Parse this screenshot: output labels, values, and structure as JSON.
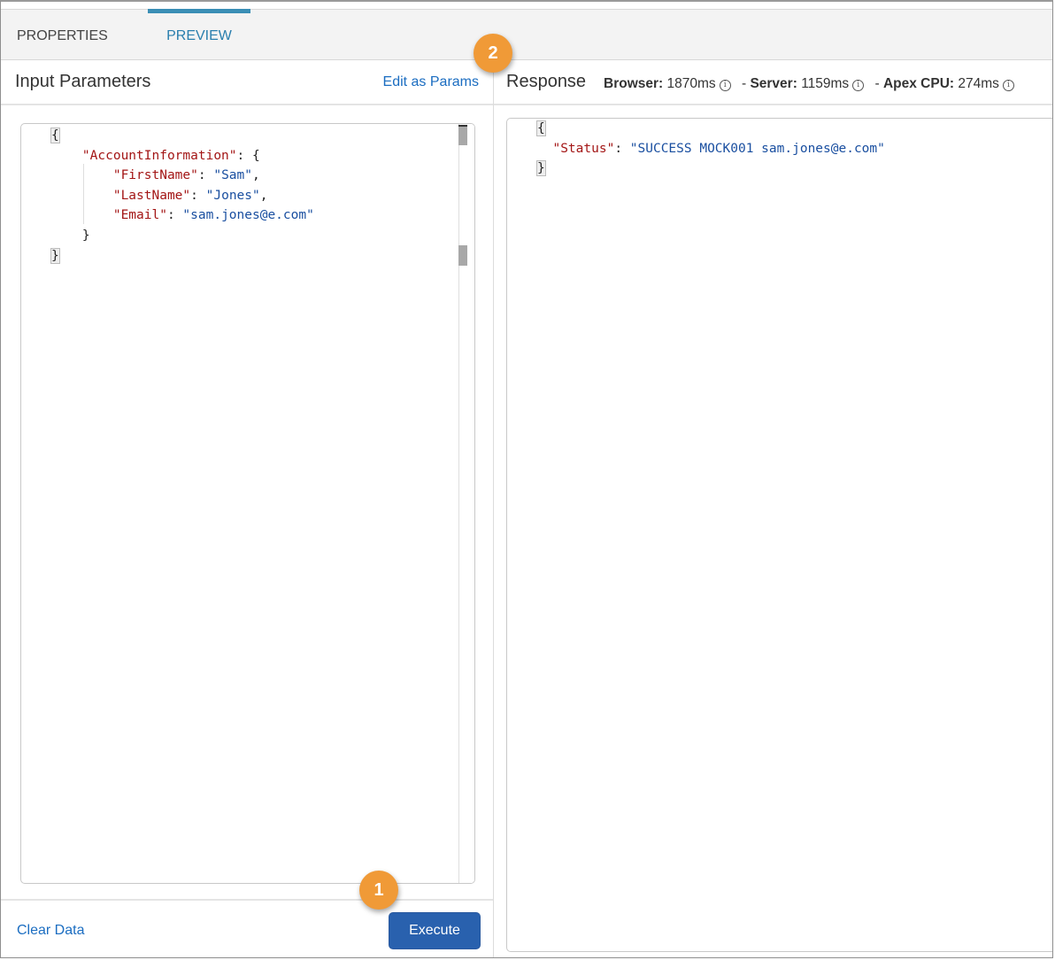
{
  "tabs": [
    {
      "label": "PROPERTIES",
      "active": false
    },
    {
      "label": "PREVIEW",
      "active": true
    }
  ],
  "input_panel": {
    "title": "Input Parameters",
    "edit_link": "Edit as Params",
    "code_lines": [
      [
        {
          "t": "{",
          "c": "brace-hl"
        }
      ],
      [
        {
          "t": "    "
        },
        {
          "t": "\"AccountInformation\"",
          "c": "key"
        },
        {
          "t": ": {"
        }
      ],
      [
        {
          "t": "        "
        },
        {
          "t": "\"FirstName\"",
          "c": "key"
        },
        {
          "t": ": "
        },
        {
          "t": "\"Sam\"",
          "c": "str"
        },
        {
          "t": ","
        }
      ],
      [
        {
          "t": "        "
        },
        {
          "t": "\"LastName\"",
          "c": "key"
        },
        {
          "t": ": "
        },
        {
          "t": "\"Jones\"",
          "c": "str"
        },
        {
          "t": ","
        }
      ],
      [
        {
          "t": "        "
        },
        {
          "t": "\"Email\"",
          "c": "key"
        },
        {
          "t": ": "
        },
        {
          "t": "\"sam.jones@e.com\"",
          "c": "str"
        }
      ],
      [
        {
          "t": "    }"
        }
      ],
      [
        {
          "t": "}",
          "c": "brace-hl"
        }
      ]
    ]
  },
  "response_panel": {
    "title": "Response",
    "metrics": [
      {
        "label": "Browser:",
        "value": "1870ms",
        "prefix": ""
      },
      {
        "label": "Server:",
        "value": "1159ms",
        "prefix": "- "
      },
      {
        "label": "Apex CPU:",
        "value": "274ms",
        "prefix": "- "
      }
    ],
    "info_icon": "ⓘ",
    "code_lines": [
      [
        {
          "t": "{",
          "c": "brace-hl"
        }
      ],
      [
        {
          "t": "  "
        },
        {
          "t": "\"Status\"",
          "c": "key"
        },
        {
          "t": ": "
        },
        {
          "t": "\"SUCCESS MOCK001 sam.jones@e.com\"",
          "c": "str"
        }
      ],
      [
        {
          "t": "}",
          "c": "brace-hl"
        }
      ]
    ]
  },
  "footer": {
    "clear_label": "Clear Data",
    "execute_label": "Execute"
  },
  "callouts": [
    {
      "number": "1",
      "target": "execute-button"
    },
    {
      "number": "2",
      "target": "edit-as-params-link"
    }
  ],
  "colors": {
    "accent": "#3a8eb5",
    "link": "#1b6dc1",
    "button": "#2961ae",
    "callout": "#f09a37",
    "json_key": "#a31515",
    "json_string": "#1a4fa0"
  }
}
